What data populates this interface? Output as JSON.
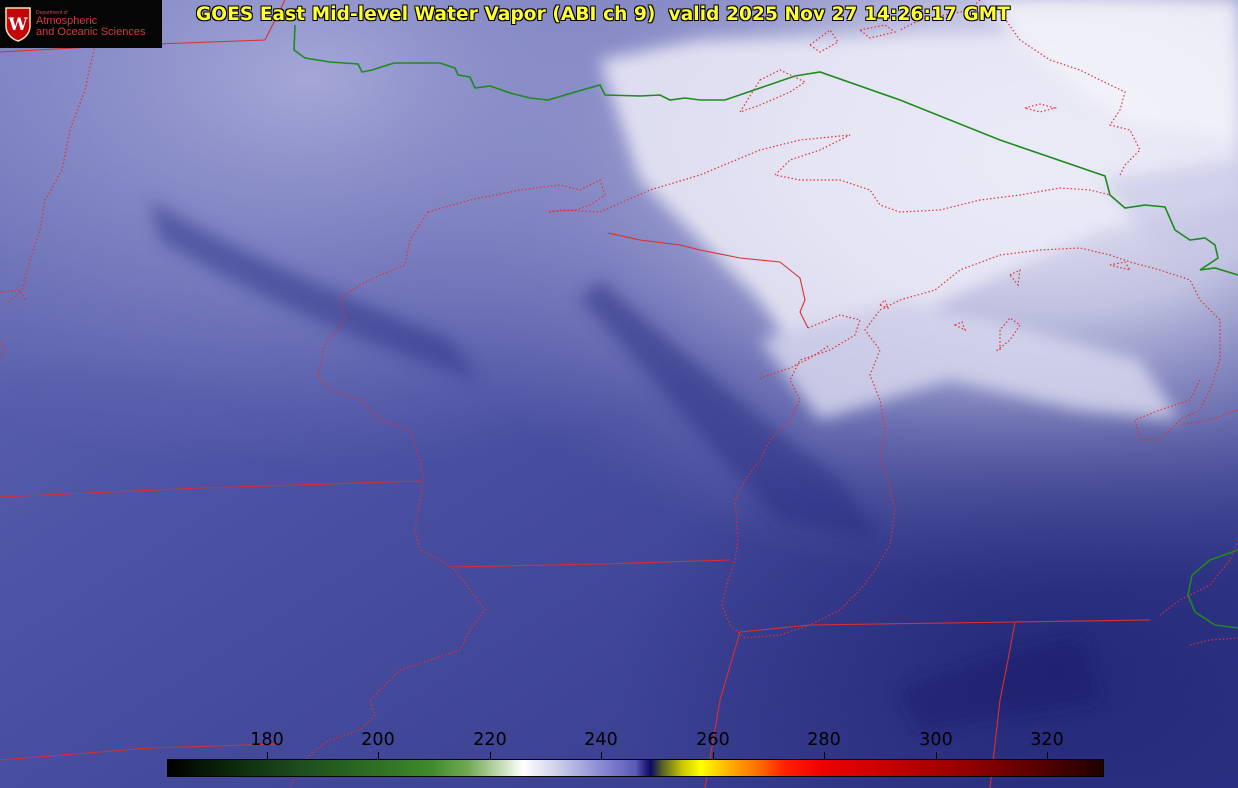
{
  "title": "GOES East Mid-level Water Vapor (ABI ch 9)  valid 2025 Nov 27 14:26:17 GMT",
  "logo": {
    "department_line": "Department of",
    "line1": "Atmospheric",
    "line2": "and Oceanic Sciences",
    "crest_letter": "W"
  },
  "colorbar": {
    "tick_labels": [
      "180",
      "200",
      "220",
      "240",
      "260",
      "280",
      "300",
      "320"
    ]
  },
  "colors": {
    "state_border": "#e03030",
    "international_border": "#1f8a1f",
    "title_text": "#ffff33"
  },
  "icons": [
    "uw-crest-icon"
  ]
}
